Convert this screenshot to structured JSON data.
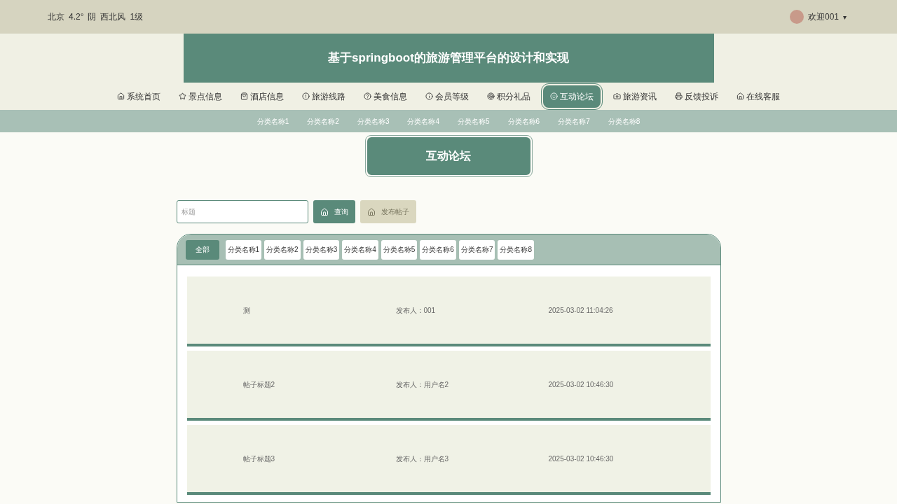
{
  "top_bar": {
    "weather": [
      "北京",
      "4.2°",
      "阴",
      "西北风",
      "1级"
    ],
    "user": "欢迎001",
    "caret": "▾"
  },
  "site_title": "基于springboot的旅游管理平台的设计和实现",
  "nav": [
    {
      "label": "系统首页",
      "selected": false
    },
    {
      "label": "景点信息",
      "selected": false
    },
    {
      "label": "酒店信息",
      "selected": false
    },
    {
      "label": "旅游线路",
      "selected": false
    },
    {
      "label": "美食信息",
      "selected": false
    },
    {
      "label": "会员等级",
      "selected": false
    },
    {
      "label": "积分礼品",
      "selected": false
    },
    {
      "label": "互动论坛",
      "selected": true
    },
    {
      "label": "旅游资讯",
      "selected": false
    },
    {
      "label": "反馈投诉",
      "selected": false
    },
    {
      "label": "在线客服",
      "selected": false
    }
  ],
  "sub_nav": [
    "分类名称1",
    "分类名称2",
    "分类名称3",
    "分类名称4",
    "分类名称5",
    "分类名称6",
    "分类名称7",
    "分类名称8"
  ],
  "page_title": "互动论坛",
  "search": {
    "placeholder": "标题",
    "query_button": "查询",
    "post_button": "发布帖子"
  },
  "category_tabs": [
    {
      "label": "全部",
      "selected": true
    },
    {
      "label": "分类名称1",
      "selected": false
    },
    {
      "label": "分类名称2",
      "selected": false
    },
    {
      "label": "分类名称3",
      "selected": false
    },
    {
      "label": "分类名称4",
      "selected": false
    },
    {
      "label": "分类名称5",
      "selected": false
    },
    {
      "label": "分类名称6",
      "selected": false
    },
    {
      "label": "分类名称7",
      "selected": false
    },
    {
      "label": "分类名称8",
      "selected": false
    }
  ],
  "posts": [
    {
      "title": "测",
      "author": "发布人：001",
      "time": "2025-03-02 11:04:26"
    },
    {
      "title": "帖子标题2",
      "author": "发布人：用户名2",
      "time": "2025-03-02 10:46:30"
    },
    {
      "title": "帖子标题3",
      "author": "发布人：用户名3",
      "time": "2025-03-02 10:46:30"
    }
  ]
}
